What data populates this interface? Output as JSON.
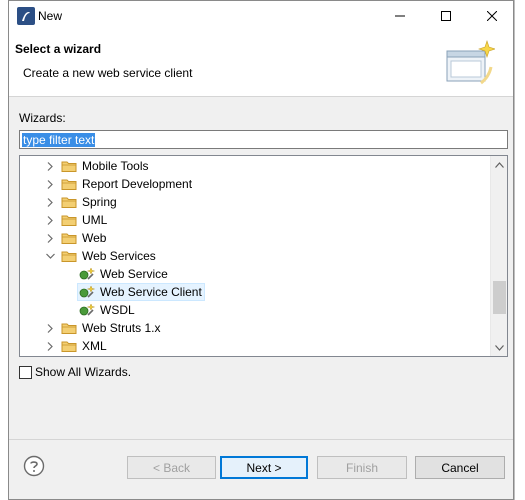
{
  "window": {
    "title": "New"
  },
  "banner": {
    "heading": "Select a wizard",
    "description": "Create a new web service client"
  },
  "wizards_label": "Wizards:",
  "filter": {
    "value": "type filter text"
  },
  "tree": [
    {
      "label": "Mobile Tools",
      "kind": "folder",
      "state": "collapsed",
      "level": 0
    },
    {
      "label": "Report Development",
      "kind": "folder",
      "state": "collapsed",
      "level": 0
    },
    {
      "label": "Spring",
      "kind": "folder",
      "state": "collapsed",
      "level": 0
    },
    {
      "label": "UML",
      "kind": "folder",
      "state": "collapsed",
      "level": 0
    },
    {
      "label": "Web",
      "kind": "folder",
      "state": "collapsed",
      "level": 0
    },
    {
      "label": "Web Services",
      "kind": "folder",
      "state": "expanded",
      "level": 0
    },
    {
      "label": "Web Service",
      "kind": "wizard",
      "level": 1
    },
    {
      "label": "Web Service Client",
      "kind": "wizard",
      "level": 1,
      "selected": true
    },
    {
      "label": "WSDL",
      "kind": "wizard",
      "level": 1
    },
    {
      "label": "Web Struts 1.x",
      "kind": "folder",
      "state": "collapsed",
      "level": 0
    },
    {
      "label": "XML",
      "kind": "folder",
      "state": "collapsed",
      "level": 0
    }
  ],
  "show_all": {
    "label": "Show All Wizards.",
    "checked": false
  },
  "buttons": {
    "back": "< Back",
    "next": "Next >",
    "finish": "Finish",
    "cancel": "Cancel"
  },
  "colors": {
    "selection": "#3a8ee6",
    "row_selected": "#e5f3ff",
    "default_button_border": "#0078d7",
    "folder": "#e8b84a"
  }
}
